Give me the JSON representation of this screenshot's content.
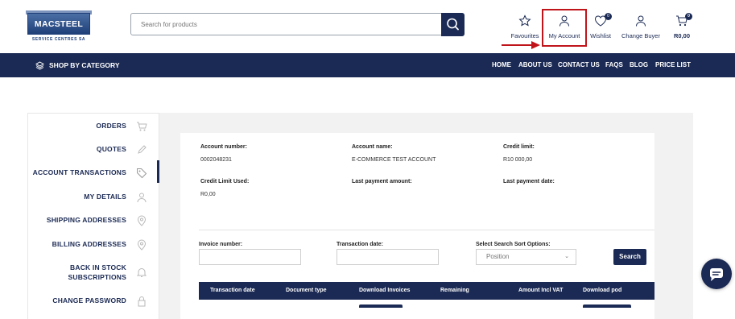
{
  "header": {
    "logo_text": "MACSTEEL",
    "logo_subtext": "SERVICE CENTRES SA",
    "search_placeholder": "Search for products",
    "icons": [
      {
        "label": "Favourites",
        "icon": "star-icon"
      },
      {
        "label": "My Account",
        "icon": "user-icon",
        "highlighted": true
      },
      {
        "label": "Wishlist",
        "icon": "heart-icon",
        "badge": "0"
      },
      {
        "label": "Change Buyer",
        "icon": "user-icon"
      },
      {
        "label": "R0,00",
        "icon": "cart-icon",
        "badge": "0"
      }
    ]
  },
  "nav": {
    "shop_by_category": "SHOP BY CATEGORY",
    "links": [
      "HOME",
      "ABOUT US",
      "CONTACT US",
      "FAQS",
      "BLOG",
      "PRICE LIST"
    ]
  },
  "sidebar": {
    "items": [
      {
        "label": "ORDERS",
        "icon": "cart-icon"
      },
      {
        "label": "QUOTES",
        "icon": "pen-icon"
      },
      {
        "label": "ACCOUNT TRANSACTIONS",
        "icon": "tag-icon",
        "active": true
      },
      {
        "label": "MY DETAILS",
        "icon": "user-icon"
      },
      {
        "label": "SHIPPING ADDRESSES",
        "icon": "location-pin-icon"
      },
      {
        "label": "BILLING ADDRESSES",
        "icon": "location-pin-icon"
      },
      {
        "label": "BACK IN STOCK",
        "label2": "SUBSCRIPTIONS",
        "icon": "bell-icon"
      },
      {
        "label": "CHANGE PASSWORD",
        "icon": "lock-icon"
      }
    ]
  },
  "account": {
    "account_number_label": "Account number:",
    "account_number": "0002048231",
    "account_name_label": "Account name:",
    "account_name": "E-COMMERCE TEST ACCOUNT",
    "credit_limit_label": "Credit limit:",
    "credit_limit": "R10 000,00",
    "credit_used_label": "Credit Limit Used:",
    "credit_used": "R0,00",
    "last_payment_amount_label": "Last payment amount:",
    "last_payment_date_label": "Last payment date:"
  },
  "filters": {
    "invoice_number_label": "Invoice number:",
    "transaction_date_label": "Transaction date:",
    "sort_label": "Select Search Sort Options:",
    "sort_value": "Position",
    "search_button": "Search"
  },
  "table": {
    "headers": [
      "Transaction date",
      "Document type",
      "Download Invoices",
      "Remaining",
      "Amount Incl VAT",
      "Download pod"
    ]
  },
  "colors": {
    "brand_navy": "#1b2a54",
    "highlight_red": "#c0141b"
  }
}
